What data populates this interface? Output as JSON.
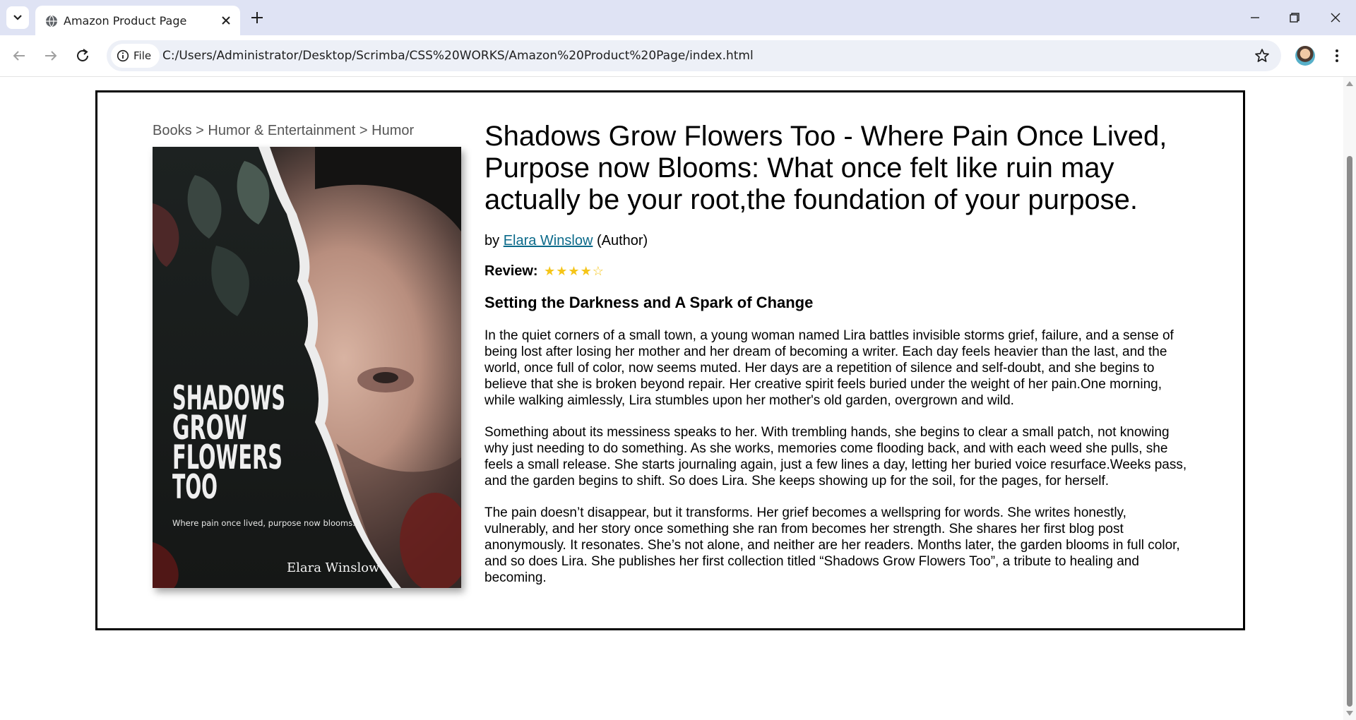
{
  "browser": {
    "tab_title": "Amazon Product Page",
    "site_chip": "File",
    "url": "C:/Users/Administrator/Desktop/Scrimba/CSS%20WORKS/Amazon%20Product%20Page/index.html"
  },
  "product": {
    "breadcrumb": "Books > Humor & Entertainment > Humor",
    "title": "Shadows Grow Flowers Too - Where Pain Once Lived, Purpose now Blooms: What once felt like ruin may actually be your root,the foundation of your purpose.",
    "by_prefix": "by",
    "author": "Elara Winslow",
    "author_role": "(Author)",
    "review_label": "Review:",
    "review_stars": "★★★★☆",
    "subtitle": "Setting the Darkness and A Spark of Change",
    "paragraphs": [
      "In the quiet corners of a small town, a young woman named Lira battles invisible storms grief, failure, and a sense of being lost after losing her mother and her dream of becoming a writer. Each day feels heavier than the last, and the world, once full of color, now seems muted. Her days are a repetition of silence and self-doubt, and she begins to believe that she is broken beyond repair. Her creative spirit feels buried under the weight of her pain.One morning, while walking aimlessly, Lira stumbles upon her mother's old garden, overgrown and wild.",
      "Something about its messiness speaks to her. With trembling hands, she begins to clear a small patch, not knowing why just needing to do something. As she works, memories come flooding back, and with each weed she pulls, she feels a small release. She starts journaling again, just a few lines a day, letting her buried voice resurface.Weeks pass, and the garden begins to shift. So does Lira. She keeps showing up for the soil, for the pages, for herself.",
      "The pain doesn’t disappear, but it transforms. Her grief becomes a wellspring for words. She writes honestly, vulnerably, and her story once something she ran from becomes her strength. She shares her first blog post anonymously. It resonates. She’s not alone, and neither are her readers. Months later, the garden blooms in full color, and so does Lira. She publishes her first collection titled “Shadows Grow Flowers Too”, a tribute to healing and becoming."
    ],
    "cover": {
      "title_lines": [
        "SHADOWS",
        "GROW",
        "FLOWERS",
        "TOO"
      ],
      "tagline": "Where pain once lived, purpose now blooms.",
      "author": "Elara Winslow"
    }
  },
  "colors": {
    "link": "#0b6a8a",
    "stars": "#f5c518",
    "tabbar": "#dfe3f4"
  }
}
